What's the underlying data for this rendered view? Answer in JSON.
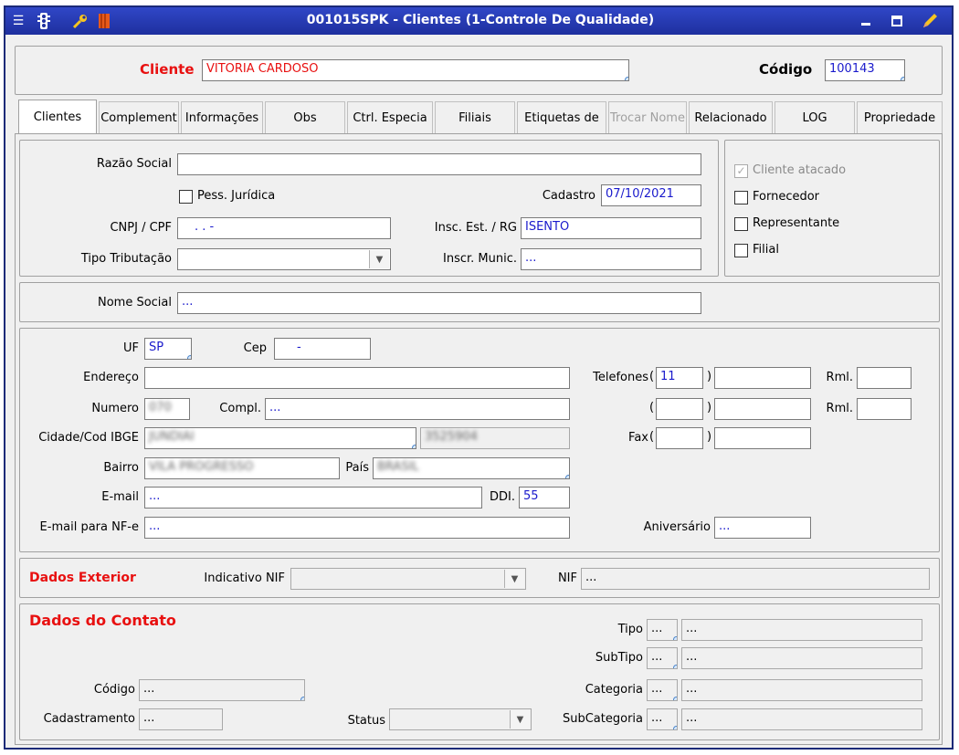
{
  "window": {
    "title": "001015SPK - Clientes (1-Controle De Qualidade)"
  },
  "header": {
    "cliente_label": "Cliente",
    "cliente_value": "VITORIA CARDOSO",
    "codigo_label": "Código",
    "codigo_value": "100143"
  },
  "tabs": [
    {
      "label": "Clientes"
    },
    {
      "label": "Complement"
    },
    {
      "label": "Informações"
    },
    {
      "label": "Obs"
    },
    {
      "label": "Ctrl. Especia"
    },
    {
      "label": "Filiais"
    },
    {
      "label": "Etiquetas de"
    },
    {
      "label": "Trocar Nome"
    },
    {
      "label": "Relacionado"
    },
    {
      "label": "LOG"
    },
    {
      "label": "Propriedade"
    }
  ],
  "cadastro": {
    "razao_social_label": "Razão Social",
    "razao_social_value": "",
    "pess_juridica_label": "Pess. Jurídica",
    "cadastro_label": "Cadastro",
    "cadastro_value": "07/10/2021",
    "cnpj_label": "CNPJ / CPF",
    "cnpj_value": ". . -",
    "insc_label": "Insc. Est. / RG",
    "insc_value": "ISENTO",
    "tipo_trib_label": "Tipo Tributação",
    "tipo_trib_value": "",
    "inscr_munic_label": "Inscr. Munic.",
    "inscr_munic_value": "...",
    "cliente_atacado_label": "Cliente atacado",
    "fornecedor_label": "Fornecedor",
    "representante_label": "Representante",
    "filial_label": "Filial"
  },
  "nome_social": {
    "label": "Nome Social",
    "value": "..."
  },
  "endereco": {
    "uf_label": "UF",
    "uf_value": "SP",
    "cep_label": "Cep",
    "cep_value": "-",
    "endereco_label": "Endereço",
    "endereco_value": "",
    "numero_label": "Numero",
    "numero_value": "070",
    "compl_label": "Compl.",
    "compl_value": "...",
    "cidade_label": "Cidade/Cod IBGE",
    "cidade_value": "JUNDIAI",
    "ibge_value": "3525904",
    "bairro_label": "Bairro",
    "bairro_value": "VILA PROGRESSO",
    "pais_label": "País",
    "pais_value": "BRASIL",
    "email_label": "E-mail",
    "email_value": "...",
    "ddi_label": "DDI.",
    "ddi_value": "55",
    "email_nfe_label": "E-mail para NF-e",
    "email_nfe_value": "...",
    "telefones_label": "Telefones",
    "ddd1_value": "11",
    "rml_label": "Rml.",
    "fax_label": "Fax",
    "aniversario_label": "Aniversário",
    "aniversario_value": "..."
  },
  "exterior": {
    "title": "Dados Exterior",
    "indicativo_label": "Indicativo NIF",
    "nif_label": "NIF",
    "nif_value": "..."
  },
  "contato": {
    "title": "Dados do Contato",
    "codigo_label": "Código",
    "codigo_value": "...",
    "cadastramento_label": "Cadastramento",
    "cadastramento_value": "...",
    "status_label": "Status",
    "tipo_label": "Tipo",
    "subtipo_label": "SubTipo",
    "categoria_label": "Categoria",
    "subcategoria_label": "SubCategoria",
    "placeholder": "..."
  },
  "colors": {
    "title_bar": "#1e2f9e",
    "accent_red": "#e81010",
    "value_blue": "#1a1acc"
  }
}
